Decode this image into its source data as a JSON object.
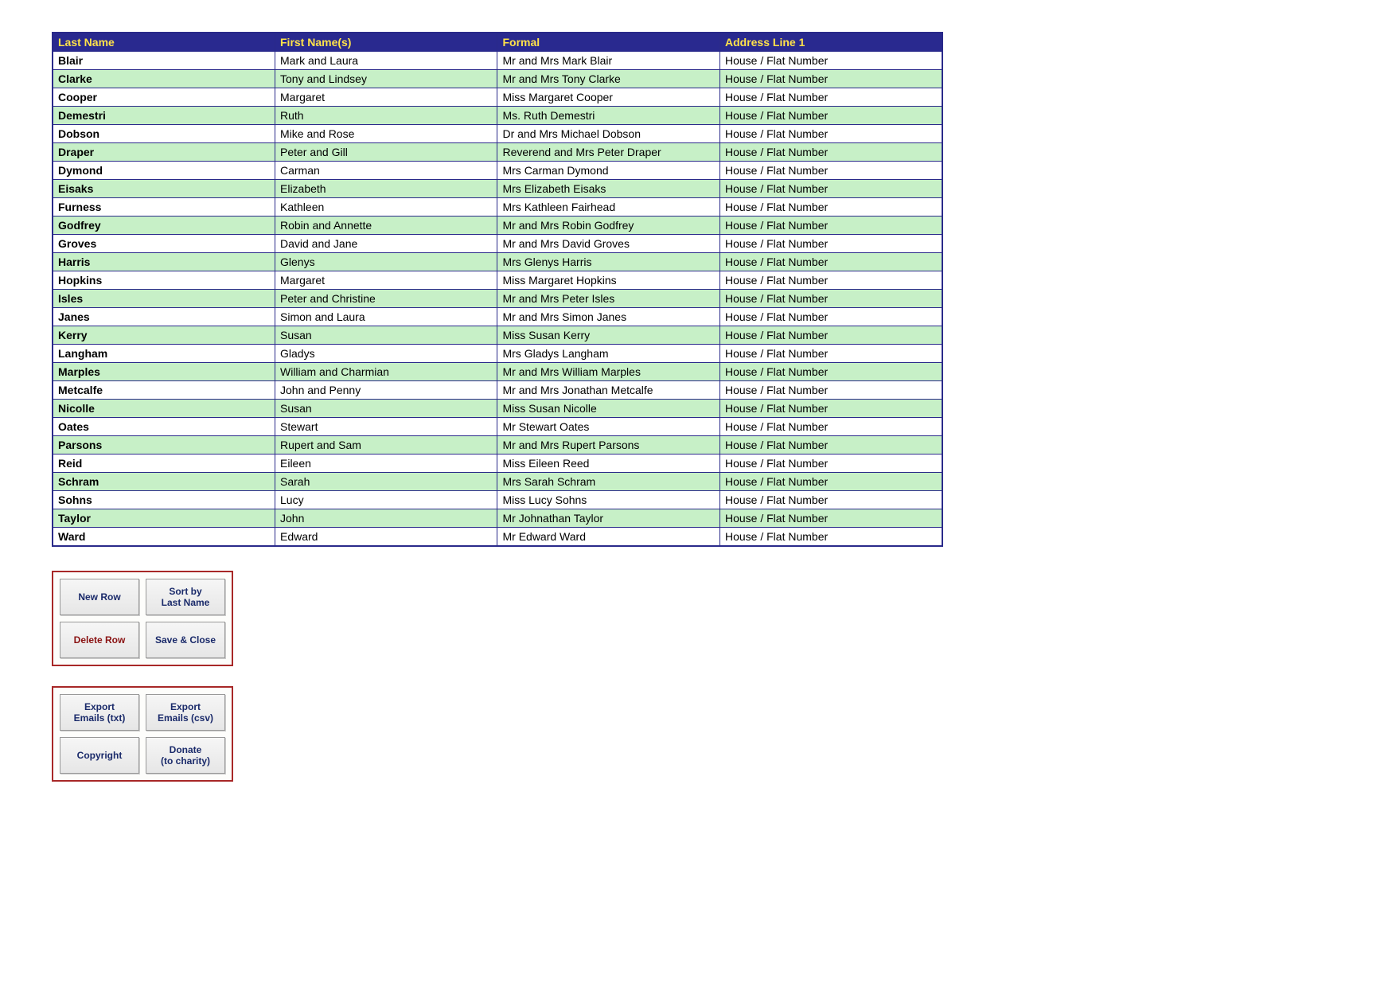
{
  "table": {
    "headers": [
      "Last Name",
      "First Name(s)",
      "Formal",
      "Address Line 1"
    ],
    "colWidths": [
      "280px",
      "280px",
      "280px",
      "280px"
    ],
    "rows": [
      {
        "last": "Blair",
        "first": "Mark and Laura",
        "formal": "Mr and Mrs Mark Blair",
        "addr": "House / Flat Number"
      },
      {
        "last": "Clarke",
        "first": "Tony and Lindsey",
        "formal": "Mr and Mrs Tony Clarke",
        "addr": "House / Flat Number"
      },
      {
        "last": "Cooper",
        "first": "Margaret",
        "formal": "Miss Margaret Cooper",
        "addr": "House / Flat Number"
      },
      {
        "last": "Demestri",
        "first": "Ruth",
        "formal": "Ms. Ruth Demestri",
        "addr": "House / Flat Number"
      },
      {
        "last": "Dobson",
        "first": "Mike and Rose",
        "formal": "Dr and Mrs Michael Dobson",
        "addr": "House / Flat Number"
      },
      {
        "last": "Draper",
        "first": "Peter and Gill",
        "formal": "Reverend and Mrs Peter Draper",
        "addr": "House / Flat Number"
      },
      {
        "last": "Dymond",
        "first": "Carman",
        "formal": "Mrs Carman Dymond",
        "addr": "House / Flat Number"
      },
      {
        "last": "Eisaks",
        "first": "Elizabeth",
        "formal": "Mrs Elizabeth Eisaks",
        "addr": "House / Flat Number"
      },
      {
        "last": "Furness",
        "first": "Kathleen",
        "formal": "Mrs Kathleen Fairhead",
        "addr": "House / Flat Number"
      },
      {
        "last": "Godfrey",
        "first": "Robin and Annette",
        "formal": "Mr and Mrs Robin Godfrey",
        "addr": "House / Flat Number"
      },
      {
        "last": "Groves",
        "first": "David and Jane",
        "formal": "Mr and Mrs David Groves",
        "addr": "House / Flat Number"
      },
      {
        "last": "Harris",
        "first": "Glenys",
        "formal": "Mrs Glenys Harris",
        "addr": "House / Flat Number"
      },
      {
        "last": "Hopkins",
        "first": "Margaret",
        "formal": "Miss Margaret Hopkins",
        "addr": "House / Flat Number"
      },
      {
        "last": "Isles",
        "first": "Peter and Christine",
        "formal": "Mr and Mrs Peter Isles",
        "addr": "House / Flat Number"
      },
      {
        "last": "Janes",
        "first": "Simon and Laura",
        "formal": "Mr and Mrs Simon Janes",
        "addr": "House / Flat Number"
      },
      {
        "last": "Kerry",
        "first": "Susan",
        "formal": "Miss Susan Kerry",
        "addr": "House / Flat Number"
      },
      {
        "last": "Langham",
        "first": "Gladys",
        "formal": "Mrs Gladys Langham",
        "addr": "House / Flat Number"
      },
      {
        "last": "Marples",
        "first": "William and Charmian",
        "formal": "Mr and Mrs William Marples",
        "addr": "House / Flat Number"
      },
      {
        "last": "Metcalfe",
        "first": "John and Penny",
        "formal": "Mr and Mrs Jonathan Metcalfe",
        "addr": "House / Flat Number"
      },
      {
        "last": "Nicolle",
        "first": "Susan",
        "formal": "Miss Susan Nicolle",
        "addr": "House / Flat Number"
      },
      {
        "last": "Oates",
        "first": "Stewart",
        "formal": "Mr Stewart Oates",
        "addr": "House / Flat Number"
      },
      {
        "last": "Parsons",
        "first": "Rupert and Sam",
        "formal": "Mr and Mrs Rupert Parsons",
        "addr": "House / Flat Number"
      },
      {
        "last": "Reid",
        "first": "Eileen",
        "formal": "Miss Eileen Reed",
        "addr": "House / Flat Number"
      },
      {
        "last": "Schram",
        "first": "Sarah",
        "formal": "Mrs Sarah Schram",
        "addr": "House / Flat Number"
      },
      {
        "last": "Sohns",
        "first": "Lucy",
        "formal": "Miss Lucy Sohns",
        "addr": "House / Flat Number"
      },
      {
        "last": "Taylor",
        "first": "John",
        "formal": "Mr Johnathan Taylor",
        "addr": "House / Flat Number"
      },
      {
        "last": "Ward",
        "first": "Edward",
        "formal": "Mr Edward Ward",
        "addr": "House / Flat Number"
      }
    ]
  },
  "buttons": {
    "newRow": "New Row",
    "sortLast": "Sort by\nLast Name",
    "deleteRow": "Delete Row",
    "saveClose": "Save & Close",
    "exportTxt": "Export\nEmails (txt)",
    "exportCsv": "Export\nEmails (csv)",
    "copyright": "Copyright",
    "donate": "Donate\n(to charity)"
  }
}
